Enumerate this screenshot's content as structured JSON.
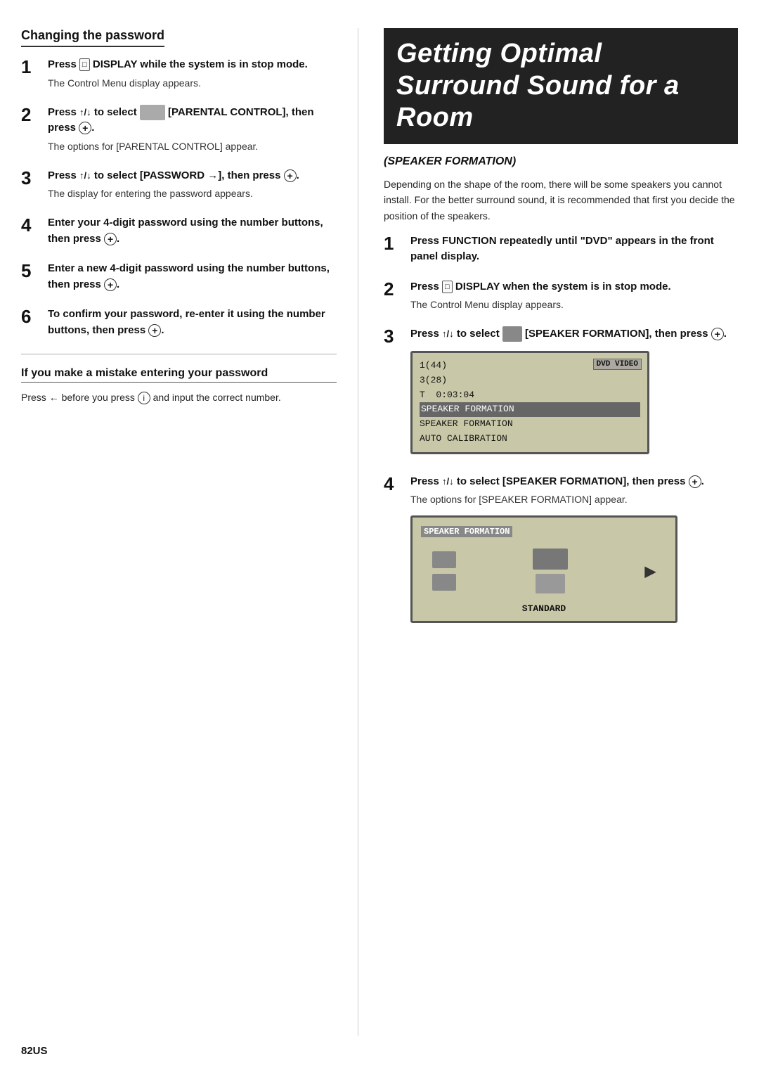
{
  "page": {
    "page_number": "82US"
  },
  "left_col": {
    "section1": {
      "heading": "Changing the password",
      "steps": [
        {
          "num": "1",
          "bold": "Press Ⓒ DISPLAY while the system is in stop mode.",
          "sub": "The Control Menu display appears."
        },
        {
          "num": "2",
          "bold": "Press ↑/↓ to select [PARENTAL CONTROL], then press ⊕.",
          "sub": "The options for [PARENTAL CONTROL] appear."
        },
        {
          "num": "3",
          "bold": "Press ↑/↓ to select [PASSWORD →], then press ⊕.",
          "sub": "The display for entering the password appears."
        },
        {
          "num": "4",
          "bold": "Enter your 4-digit password using the number buttons, then press ⊕.",
          "sub": ""
        },
        {
          "num": "5",
          "bold": "Enter a new 4-digit password using the number buttons, then press ⊕.",
          "sub": ""
        },
        {
          "num": "6",
          "bold": "To confirm your password, re-enter it using the number buttons, then press ⊕.",
          "sub": ""
        }
      ]
    },
    "section2": {
      "heading": "If you make a mistake entering your password",
      "text": "Press ← before you press Ⓘ and input the correct number."
    }
  },
  "right_col": {
    "title": "Getting Optimal Surround Sound for a Room",
    "subtitle": "(SPEAKER FORMATION)",
    "intro": "Depending on the shape of the room, there will be some speakers you cannot install. For the better surround sound, it is recommended that first you decide the position of the speakers.",
    "steps": [
      {
        "num": "1",
        "bold": "Press FUNCTION repeatedly until “DVD” appears in the front panel display.",
        "sub": ""
      },
      {
        "num": "2",
        "bold": "Press Ⓒ DISPLAY when the system is in stop mode.",
        "sub": "The Control Menu display appears."
      },
      {
        "num": "3",
        "bold": "Press ↑/↓ to select [SPEAKER FORMATION], then press ⊕.",
        "sub": "",
        "has_lcd": true
      },
      {
        "num": "4",
        "bold": "Press ↑/↓ to select [SPEAKER FORMATION], then press ⊕.",
        "sub": "The options for [SPEAKER FORMATION] appear.",
        "has_speaker_display": true
      }
    ],
    "lcd": {
      "line1": "1(44)",
      "line2": "3(28)",
      "line3": "T  0:03:04",
      "highlight": "SPEAKER FORMATION",
      "row4": "SPEAKER FORMATION",
      "row5": "AUTO CALIBRATION",
      "dvd_badge": "DVD VIDEO"
    },
    "speaker_display": {
      "header": "SPEAKER FORMATION",
      "label": "STANDARD"
    }
  }
}
